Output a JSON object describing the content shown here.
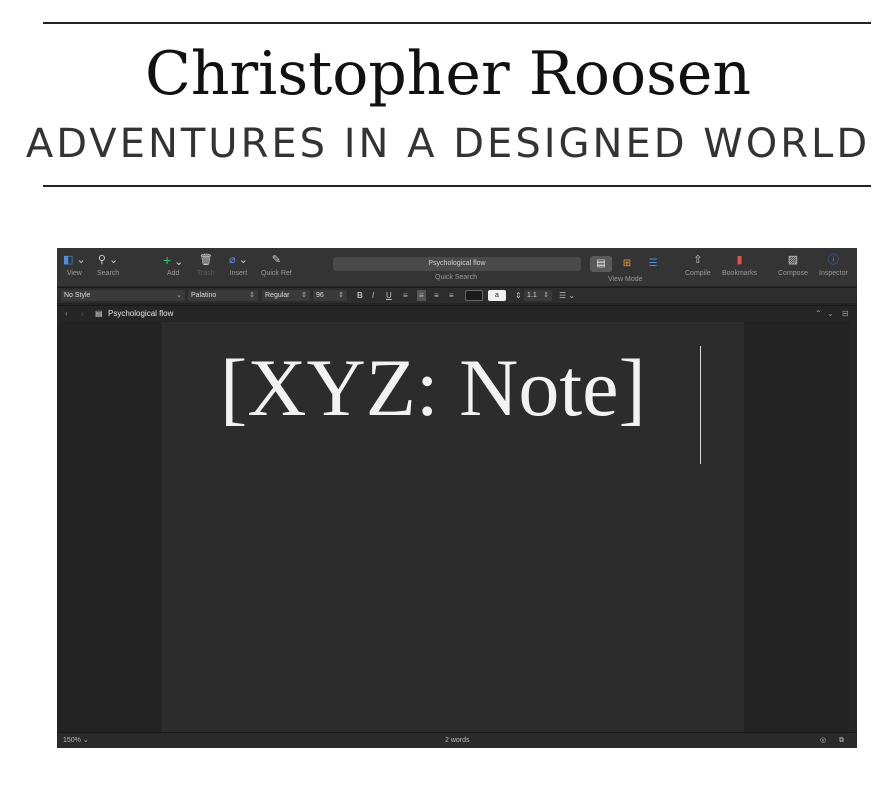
{
  "site": {
    "title": "Christopher Roosen",
    "tagline": "ADVENTURES IN A DESIGNED WORLD"
  },
  "toolbar": {
    "view_label": "View",
    "search_label": "Search",
    "add_label": "Add",
    "trash_label": "Trash",
    "insert_label": "Insert",
    "quickref_label": "Quick Ref",
    "document_title": "Psychological flow",
    "quicksearch_label": "Quick Search",
    "viewmode_label": "View Mode",
    "compile_label": "Compile",
    "bookmarks_label": "Bookmarks",
    "compose_label": "Compose",
    "inspector_label": "Inspector"
  },
  "format_bar": {
    "style": "No Style",
    "font": "Palatino",
    "weight": "Regular",
    "size": "96",
    "bold": "B",
    "italic": "I",
    "underline": "U",
    "highlight": "a",
    "line_spacing": "1.1"
  },
  "path_bar": {
    "document": "Psychological flow"
  },
  "editor": {
    "text": "[XYZ: Note]"
  },
  "status_bar": {
    "zoom": "150%",
    "word_count": "2 words"
  },
  "colors": {
    "add_green": "#34c759",
    "insert_blue": "#5b8def",
    "viewmode_orange": "#f0a030",
    "viewmode_blue": "#4a90e2",
    "bookmark_red": "#e5534b",
    "inspector_blue": "#2f7cf6"
  }
}
